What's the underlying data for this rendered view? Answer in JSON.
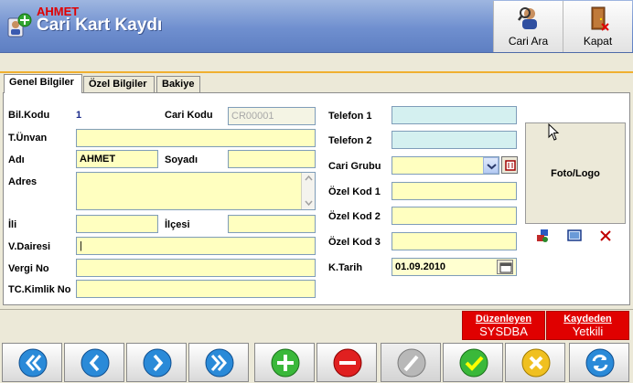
{
  "window": {
    "title": "Cari Kart Kaydı"
  },
  "toolbar": {
    "search_label": "Cari Ara",
    "close_label": "Kapat"
  },
  "record": {
    "name_display": "AHMET"
  },
  "tabs": [
    {
      "label": "Genel Bilgiler",
      "active": true
    },
    {
      "label": "Özel Bilgiler",
      "active": false
    },
    {
      "label": "Bakiye",
      "active": false
    }
  ],
  "form": {
    "bil_kodu_label": "Bil.Kodu",
    "bil_kodu_value": "1",
    "cari_kodu_label": "Cari Kodu",
    "cari_kodu_value": "CR00001",
    "unvan_label": "T.Ünvan",
    "unvan_value": "",
    "adi_label": "Adı",
    "adi_value": "AHMET",
    "soyadi_label": "Soyadı",
    "soyadi_value": "",
    "adres_label": "Adres",
    "adres_value": "",
    "ili_label": "İli",
    "ili_value": "",
    "ilcesi_label": "İlçesi",
    "ilcesi_value": "",
    "vdairesi_label": "V.Dairesi",
    "vdairesi_value": "|",
    "vergino_label": "Vergi No",
    "vergino_value": "",
    "tckimlik_label": "TC.Kimlik No",
    "tckimlik_value": "",
    "telefon1_label": "Telefon 1",
    "telefon1_value": "",
    "telefon2_label": "Telefon 2",
    "telefon2_value": "",
    "carigrubu_label": "Cari Grubu",
    "carigrubu_value": "",
    "ozelkod1_label": "Özel Kod 1",
    "ozelkod1_value": "",
    "ozelkod2_label": "Özel Kod 2",
    "ozelkod2_value": "",
    "ozelkod3_label": "Özel Kod 3",
    "ozelkod3_value": "",
    "ktarih_label": "K.Tarih",
    "ktarih_value": "01.09.2010",
    "photo_label": "Foto/Logo"
  },
  "footer": {
    "editor_title": "Düzenleyen",
    "editor_value": "SYSDBA",
    "saver_title": "Kaydeden",
    "saver_value": "Yetkili"
  },
  "colors": {
    "accent": "#e00000",
    "field": "#ffffc0",
    "field_alt": "#d4f0f0",
    "titlebar": "#6f8fcf"
  },
  "nav_icons": [
    "first-icon",
    "prev-icon",
    "next-icon",
    "last-icon",
    "add-icon",
    "delete-icon",
    "edit-icon",
    "save-icon",
    "cancel-icon",
    "refresh-icon"
  ]
}
